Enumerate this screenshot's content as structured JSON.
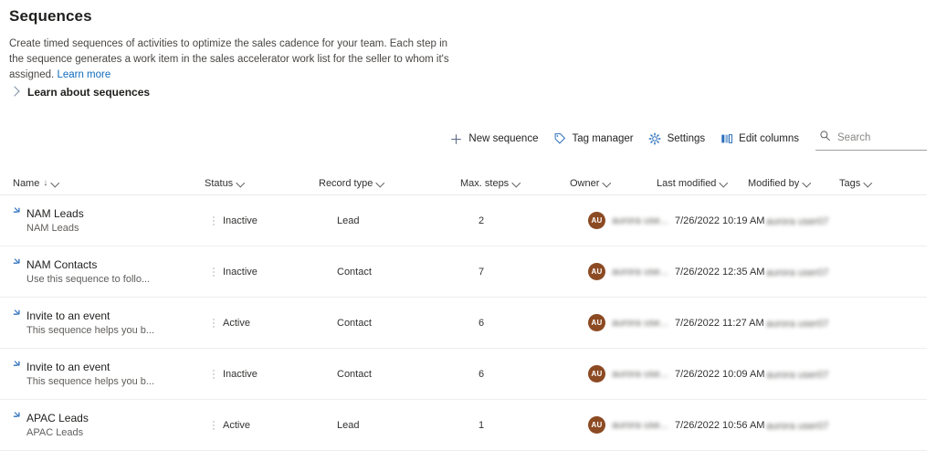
{
  "header": {
    "title": "Sequences",
    "description": "Create timed sequences of activities to optimize the sales cadence for your team. Each step in the sequence generates a work item in the sales accelerator work list for the seller to whom it's assigned.",
    "learn_more_label": "Learn more",
    "expander_label": "Learn about sequences",
    "expander_icon": "chevron-right-icon",
    "accent_color": "#0f6cbd"
  },
  "toolbar": {
    "new_sequence_label": "New sequence",
    "new_sequence_icon": "plus-icon",
    "tag_manager_label": "Tag manager",
    "tag_manager_icon": "tag-icon",
    "settings_label": "Settings",
    "settings_icon": "gear-icon",
    "edit_columns_label": "Edit columns",
    "edit_columns_icon": "columns-icon",
    "search_icon": "search-icon",
    "search_placeholder": "Search",
    "search_value": ""
  },
  "grid": {
    "columns": [
      {
        "label": "Name",
        "sort": "↓"
      },
      {
        "label": "Status",
        "sort": ""
      },
      {
        "label": "Record type",
        "sort": ""
      },
      {
        "label": "Max. steps",
        "sort": ""
      },
      {
        "label": "Owner",
        "sort": ""
      },
      {
        "label": "Last modified",
        "sort": ""
      },
      {
        "label": "Modified by",
        "sort": ""
      },
      {
        "label": "Tags",
        "sort": ""
      }
    ],
    "rows": [
      {
        "name": "NAM Leads",
        "subtitle": "NAM Leads",
        "status": "Inactive",
        "record_type": "Lead",
        "max_steps": "2",
        "owner_initials": "AU",
        "owner_name": "aurora use...",
        "last_modified": "7/26/2022 10:19 AM",
        "modified_by": "aurora user07",
        "tags": ""
      },
      {
        "name": "NAM Contacts",
        "subtitle": "Use this sequence to follo...",
        "status": "Inactive",
        "record_type": "Contact",
        "max_steps": "7",
        "owner_initials": "AU",
        "owner_name": "aurora use...",
        "last_modified": "7/26/2022 12:35 AM",
        "modified_by": "aurora user07",
        "tags": ""
      },
      {
        "name": "Invite to an event",
        "subtitle": "This sequence helps you b...",
        "status": "Active",
        "record_type": "Contact",
        "max_steps": "6",
        "owner_initials": "AU",
        "owner_name": "aurora use...",
        "last_modified": "7/26/2022 11:27 AM",
        "modified_by": "aurora user07",
        "tags": ""
      },
      {
        "name": "Invite to an event",
        "subtitle": "This sequence helps you b...",
        "status": "Inactive",
        "record_type": "Contact",
        "max_steps": "6",
        "owner_initials": "AU",
        "owner_name": "aurora use...",
        "last_modified": "7/26/2022 10:09 AM",
        "modified_by": "aurora user07",
        "tags": ""
      },
      {
        "name": "APAC Leads",
        "subtitle": "APAC Leads",
        "status": "Active",
        "record_type": "Lead",
        "max_steps": "1",
        "owner_initials": "AU",
        "owner_name": "aurora use...",
        "last_modified": "7/26/2022 10:56 AM",
        "modified_by": "aurora user07",
        "tags": ""
      }
    ]
  }
}
